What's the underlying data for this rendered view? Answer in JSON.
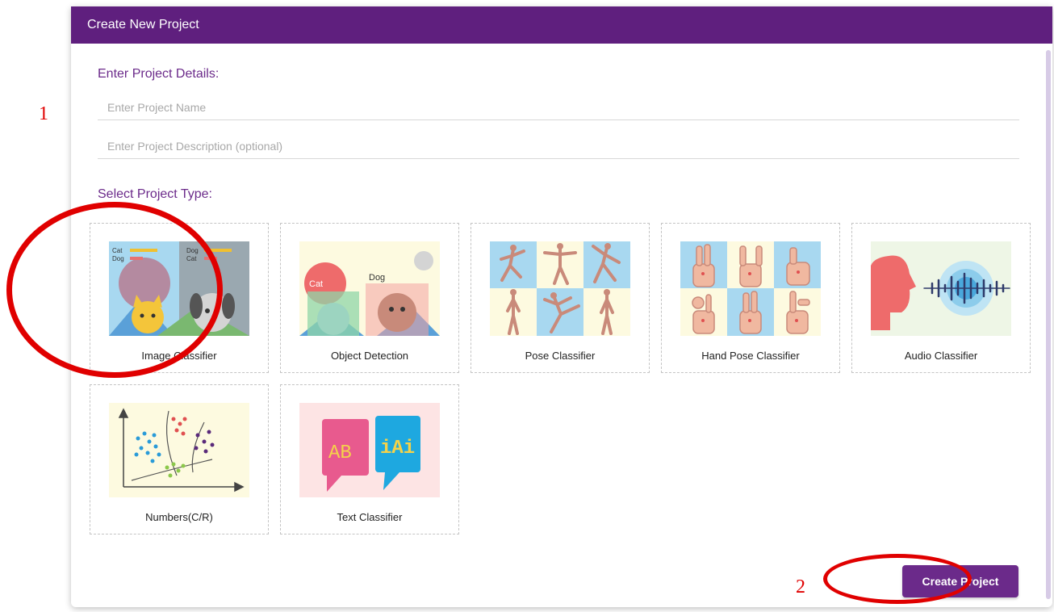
{
  "annotations": {
    "step1": "1",
    "step2": "2"
  },
  "modal": {
    "title": "Create New Project",
    "details_label": "Enter Project Details:",
    "name_placeholder": "Enter Project Name",
    "description_placeholder": "Enter Project Description (optional)",
    "type_label": "Select Project Type:",
    "project_types": [
      {
        "label": "Image Classifier",
        "icon": "image-classifier-icon"
      },
      {
        "label": "Object Detection",
        "icon": "object-detection-icon"
      },
      {
        "label": "Pose Classifier",
        "icon": "pose-classifier-icon"
      },
      {
        "label": "Hand Pose Classifier",
        "icon": "hand-pose-classifier-icon"
      },
      {
        "label": "Audio Classifier",
        "icon": "audio-classifier-icon"
      },
      {
        "label": "Numbers(C/R)",
        "icon": "numbers-icon"
      },
      {
        "label": "Text Classifier",
        "icon": "text-classifier-icon"
      }
    ],
    "illustration_text": {
      "cat": "Cat",
      "dog": "Dog",
      "ab": "AB",
      "iai": "iAi"
    },
    "create_button": "Create Project"
  },
  "colors": {
    "header": "#5f1f7e",
    "accent": "#6b2a8a",
    "annotation": "#e00000"
  }
}
